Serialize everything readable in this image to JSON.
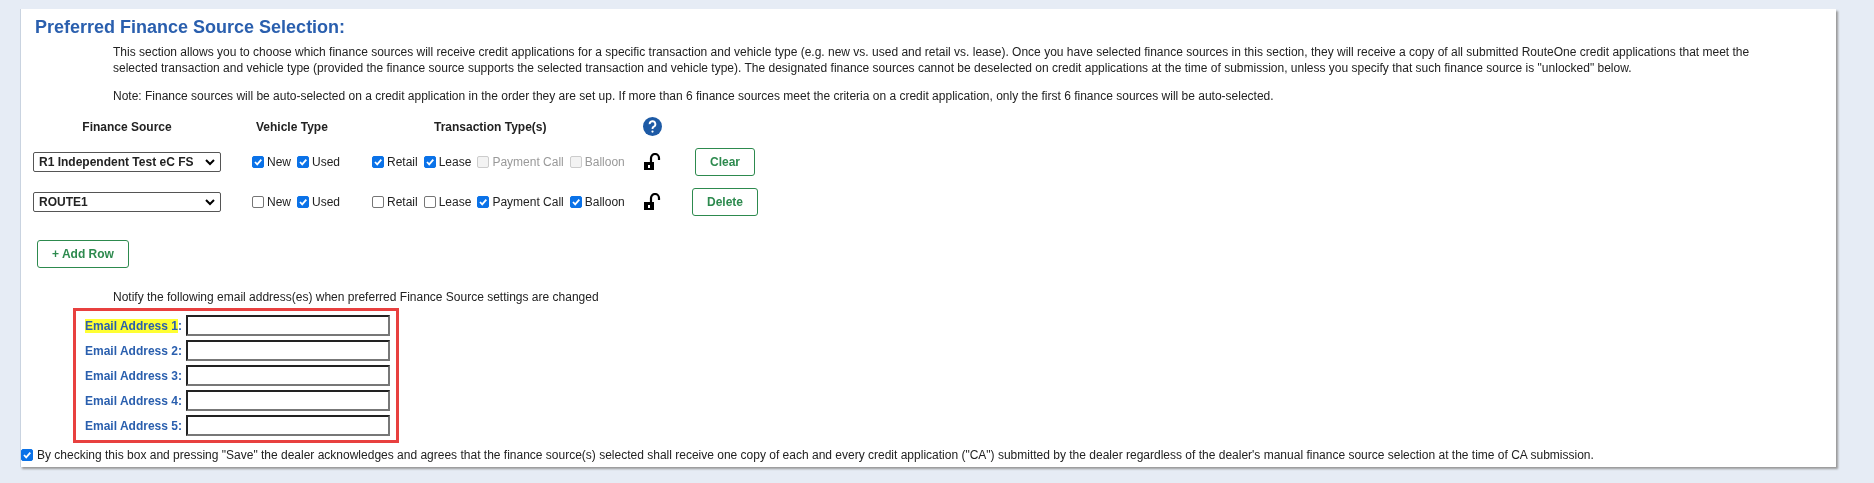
{
  "title": "Preferred Finance Source Selection:",
  "description": "This section allows you to choose which finance sources will receive credit applications for a specific transaction and vehicle type (e.g. new vs. used and retail vs. lease). Once you have selected finance sources in this section, they will receive a copy of all submitted RouteOne credit applications that meet the selected transaction and vehicle type (provided the finance source supports the selected transaction and vehicle type). The designated finance sources cannot be deselected on credit applications at the time of submission, unless you specify that such finance source is \"unlocked\" below.",
  "note": "Note: Finance sources will be auto-selected on a credit application in the order they are set up. If more than 6 finance sources meet the criteria on a credit application, only the first 6 finance sources will be auto-selected.",
  "table": {
    "columns": [
      "Finance Source",
      "Vehicle Type",
      "Transaction Type(s)"
    ],
    "rows": [
      {
        "finance_source": "R1 Independent Test eC FS",
        "vehicle_types": [
          {
            "label": "New",
            "checked": true,
            "disabled": false
          },
          {
            "label": "Used",
            "checked": true,
            "disabled": false
          }
        ],
        "transaction_types": [
          {
            "label": "Retail",
            "checked": true,
            "disabled": false
          },
          {
            "label": "Lease",
            "checked": true,
            "disabled": false
          },
          {
            "label": "Payment Call",
            "checked": false,
            "disabled": true
          },
          {
            "label": "Balloon",
            "checked": false,
            "disabled": true
          }
        ],
        "locked": false,
        "button": "Clear"
      },
      {
        "finance_source": "ROUTE1",
        "vehicle_types": [
          {
            "label": "New",
            "checked": false,
            "disabled": false
          },
          {
            "label": "Used",
            "checked": true,
            "disabled": false
          }
        ],
        "transaction_types": [
          {
            "label": "Retail",
            "checked": false,
            "disabled": false
          },
          {
            "label": "Lease",
            "checked": false,
            "disabled": false
          },
          {
            "label": "Payment Call",
            "checked": true,
            "disabled": false
          },
          {
            "label": "Balloon",
            "checked": true,
            "disabled": false
          }
        ],
        "locked": false,
        "button": "Delete"
      }
    ]
  },
  "add_row_button": "+ Add Row",
  "notify_text": "Notify the following email address(es) when preferred Finance Source settings are changed",
  "email_fields": [
    {
      "label": "Email Address 1",
      "suffix": ":",
      "highlighted": true
    },
    {
      "label": "Email Address 2",
      "suffix": ":",
      "highlighted": false
    },
    {
      "label": "Email Address 3",
      "suffix": ":",
      "highlighted": false
    },
    {
      "label": "Email Address 4",
      "suffix": ":",
      "highlighted": false
    },
    {
      "label": "Email Address 5",
      "suffix": ":",
      "highlighted": false
    }
  ],
  "acknowledgement": {
    "checked": true,
    "text": "By checking this box and pressing \"Save\" the dealer acknowledges and agrees that the finance source(s) selected shall receive one copy of each and every credit application (\"CA\") submitted by the dealer regardless of the dealer's manual finance source selection at the time of CA submission."
  }
}
